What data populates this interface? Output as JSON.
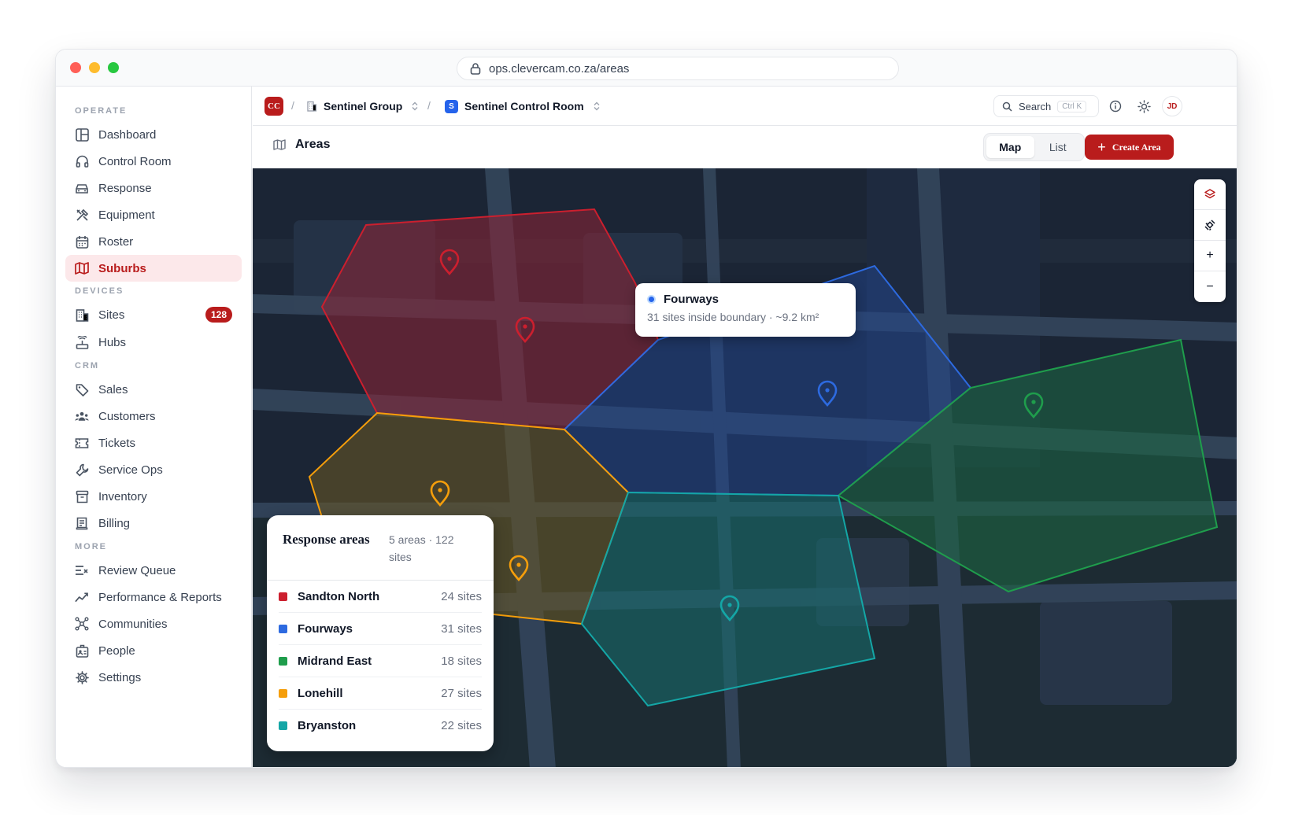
{
  "browser": {
    "url": "ops.clevercam.co.za/areas"
  },
  "sidebar": {
    "sections": [
      {
        "label": "OPERATE",
        "items": [
          {
            "label": "Dashboard",
            "icon": "dashboard-icon"
          },
          {
            "label": "Control Room",
            "icon": "headset-icon"
          },
          {
            "label": "Response",
            "icon": "car-icon"
          },
          {
            "label": "Equipment",
            "icon": "tools-icon"
          },
          {
            "label": "Roster",
            "icon": "calendar-icon"
          },
          {
            "label": "Suburbs",
            "icon": "map-icon",
            "active": true
          }
        ]
      },
      {
        "label": "DEVICES",
        "items": [
          {
            "label": "Sites",
            "icon": "building-icon",
            "badge": "128"
          },
          {
            "label": "Hubs",
            "icon": "router-icon"
          }
        ]
      },
      {
        "label": "CRM",
        "items": [
          {
            "label": "Sales",
            "icon": "tag-icon"
          },
          {
            "label": "Customers",
            "icon": "users-icon"
          },
          {
            "label": "Tickets",
            "icon": "ticket-icon"
          },
          {
            "label": "Service Ops",
            "icon": "wrench-icon"
          },
          {
            "label": "Inventory",
            "icon": "archive-icon"
          },
          {
            "label": "Billing",
            "icon": "receipt-icon"
          }
        ]
      },
      {
        "label": "MORE",
        "items": [
          {
            "label": "Review Queue",
            "icon": "list-check-icon"
          },
          {
            "label": "Performance & Reports",
            "icon": "trend-icon"
          },
          {
            "label": "Communities",
            "icon": "network-icon"
          },
          {
            "label": "People",
            "icon": "id-badge-icon"
          },
          {
            "label": "Settings",
            "icon": "gear-icon"
          }
        ]
      }
    ]
  },
  "topbar": {
    "logo": "CC",
    "org": "Sentinel Group",
    "workspace_logo": "S",
    "workspace": "Sentinel Control Room",
    "search_label": "Search",
    "search_shortcut": "Ctrl K",
    "avatar": "JD"
  },
  "page": {
    "title": "Areas",
    "view_map": "Map",
    "view_list": "List",
    "create_label": "Create Area"
  },
  "tooltip": {
    "title": "Fourways",
    "subtitle": "31 sites inside boundary · ~9.2 km²"
  },
  "legend": {
    "title": "Response areas",
    "meta": "5 areas · 122 sites",
    "areas": [
      {
        "name": "Sandton North",
        "count": "24 sites",
        "color": "#cc1f2e"
      },
      {
        "name": "Fourways",
        "count": "31 sites",
        "color": "#2d6ae0"
      },
      {
        "name": "Midrand East",
        "count": "18 sites",
        "color": "#1f9d4c"
      },
      {
        "name": "Lonehill",
        "count": "27 sites",
        "color": "#f59e0b"
      },
      {
        "name": "Bryanston",
        "count": "22 sites",
        "color": "#14a6a6"
      }
    ]
  },
  "colors": {
    "brand": "#b91c1c",
    "map_background": "#1b2535"
  }
}
